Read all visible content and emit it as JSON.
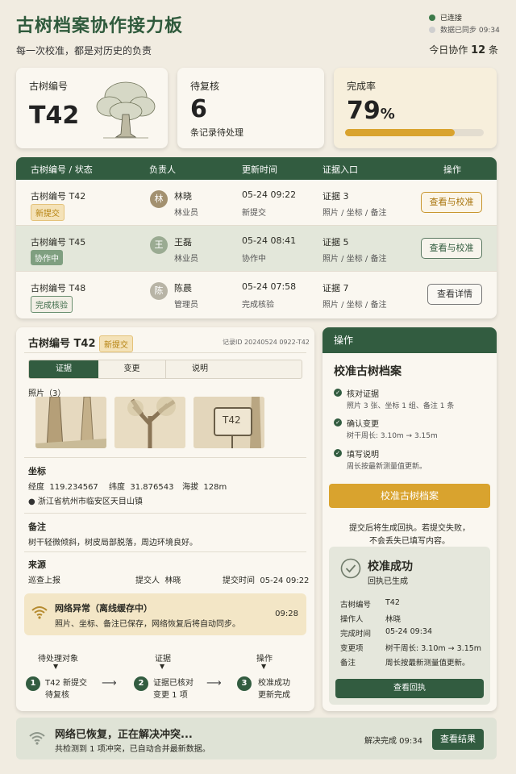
{
  "header": {
    "title": "古树档案协作接力板",
    "subtitle": "每一次校准，都是对历史的负责",
    "status_connected": "已连接",
    "status_sync": "数据已同步 09:34",
    "today_prefix": "今日协作",
    "today_count": "12",
    "today_suffix": "条"
  },
  "cards": {
    "tree_label": "古树编号",
    "tree_value": "T42",
    "pending_label": "待复核",
    "pending_value": "6",
    "pending_sub": "条记录待处理",
    "rate_label": "完成率",
    "rate_value": "79",
    "rate_unit": "%",
    "rate_progress": 0.79
  },
  "table": {
    "headers": [
      "古树编号 / 状态",
      "负责人",
      "更新时间",
      "证据入口",
      "操作"
    ],
    "rows": [
      {
        "tree": "古树编号 T42",
        "status": "新提交",
        "avatar": "林",
        "person": "林晓",
        "role": "林业员",
        "time": "05-24 09:22",
        "time_sub": "新提交",
        "evidence": "证据 3",
        "evidence_sub": "照片 / 坐标 / 备注",
        "action": "查看与校准"
      },
      {
        "tree": "古树编号 T45",
        "status": "协作中",
        "avatar": "王",
        "person": "王磊",
        "role": "林业员",
        "time": "05-24 08:41",
        "time_sub": "协作中",
        "evidence": "证据 5",
        "evidence_sub": "照片 / 坐标 / 备注",
        "action": "查看与校准"
      },
      {
        "tree": "古树编号 T48",
        "status": "完成核验",
        "avatar": "陈",
        "person": "陈晨",
        "role": "管理员",
        "time": "05-24 07:58",
        "time_sub": "完成核验",
        "evidence": "证据 7",
        "evidence_sub": "照片 / 坐标 / 备注",
        "action": "查看详情"
      }
    ]
  },
  "detail": {
    "title": "古树编号 T42 /",
    "status": "新提交",
    "record_id": "记录ID 20240524 0922-T42",
    "tabs": [
      "证据",
      "变更",
      "说明"
    ],
    "photos_label": "照片（3）",
    "photo_tag": "T42",
    "coord_label": "坐标",
    "lon_label": "经度",
    "lon": "119.234567",
    "lat_label": "纬度",
    "lat": "31.876543",
    "alt_label": "海拔",
    "alt": "128m",
    "location": "浙江省杭州市临安区天目山镇",
    "note_label": "备注",
    "note": "树干轻微倾斜，树皮局部脱落，周边环境良好。",
    "source_label": "来源",
    "source": "巡查上报",
    "submitter_label": "提交人",
    "submitter": "林晓",
    "submit_time_label": "提交时间",
    "submit_time": "05-24 09:22"
  },
  "network": {
    "title": "网络异常（离线缓存中）",
    "text": "照片、坐标、备注已保存，网络恢复后将自动同步。",
    "time": "09:28"
  },
  "flow": {
    "h1": "待处理对象",
    "h2": "证据",
    "h3": "操作",
    "s1a": "T42 新提交",
    "s1b": "待复核",
    "s2a": "证据已核对",
    "s2b": "变更 1 项",
    "s3a": "校准成功",
    "s3b": "更新完成",
    "n1": "1",
    "n2": "2",
    "n3": "3"
  },
  "ops": {
    "header": "操作",
    "title": "校准古树档案",
    "steps": [
      {
        "title": "核对证据",
        "desc": "照片 3 张、坐标 1 组、备注 1 条"
      },
      {
        "title": "确认变更",
        "desc": "树干周长:  3.10m → 3.15m"
      },
      {
        "title": "填写说明",
        "desc": "周长按最新测量值更新。"
      }
    ],
    "button": "校准古树档案",
    "hint1": "提交后将生成回执。若提交失败，",
    "hint2": "不会丢失已填写内容。"
  },
  "success": {
    "title": "校准成功",
    "sub": "回执已生成",
    "rows": [
      {
        "k": "古树编号",
        "v": "T42"
      },
      {
        "k": "操作人",
        "v": "林晓"
      },
      {
        "k": "完成时间",
        "v": "05-24 09:34"
      },
      {
        "k": "变更项",
        "v": "树干周长:  3.10m → 3.15m"
      },
      {
        "k": "备注",
        "v": "周长按最新测量值更新。"
      }
    ],
    "button": "查看回执"
  },
  "bottom": {
    "title": "网络已恢复，正在解决冲突...",
    "text": "共检测到 1 项冲突，已自动合并最新数据。",
    "status": "解决完成 09:34",
    "button": "查看结果"
  },
  "colors": {
    "primary": "#325c40",
    "gold": "#d9a32e",
    "bg": "#f1ece1"
  }
}
